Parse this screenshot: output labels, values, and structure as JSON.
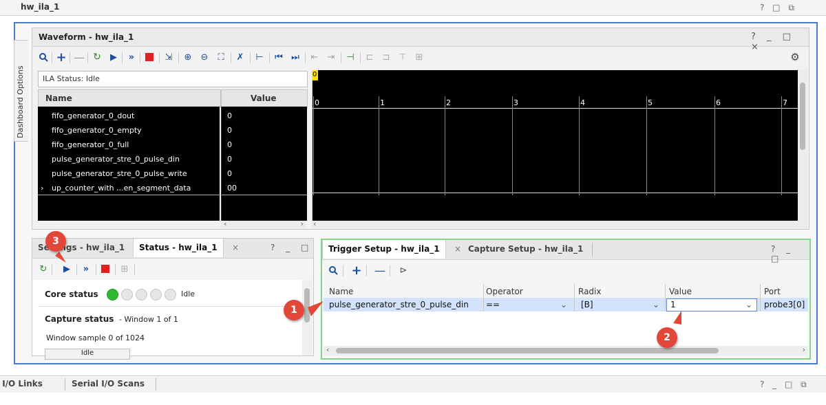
{
  "window": {
    "title": "hw_ila_1",
    "controls": "? □ ⧉"
  },
  "side_tab": {
    "label": "Dashboard Options"
  },
  "waveform": {
    "title": "Waveform - hw_ila_1",
    "controls": "? _ □ ×",
    "ila_status": "ILA Status: Idle",
    "name_header": "Name",
    "value_header": "Value",
    "cursor_marker": "0",
    "signals": [
      {
        "name": "fifo_generator_0_dout",
        "value": "0"
      },
      {
        "name": "fifo_generator_0_empty",
        "value": "0"
      },
      {
        "name": "fifo_generator_0_full",
        "value": "0"
      },
      {
        "name": "pulse_generator_stre_0_pulse_din",
        "value": "0"
      },
      {
        "name": "pulse_generator_stre_0_pulse_write",
        "value": "0"
      },
      {
        "name": "up_counter_with ...en_segment_data",
        "value": "00"
      }
    ],
    "time_ticks": [
      "0",
      "1",
      "2",
      "3",
      "4",
      "5",
      "6",
      "7"
    ]
  },
  "status_panel": {
    "tab_settings": "Settings - hw_ila_1",
    "tab_status": "Status - hw_ila_1",
    "controls": "? _ □",
    "core_status_label": "Core status",
    "core_status_value": "Idle",
    "capture_status_label": "Capture status",
    "capture_status_value": "- Window 1 of 1",
    "window_sample": "Window sample 0 of 1024",
    "idle_button": "Idle"
  },
  "trigger_panel": {
    "tab_trigger": "Trigger Setup - hw_ila_1",
    "tab_capture": "Capture Setup - hw_ila_1",
    "controls": "? _ □",
    "columns": [
      "Name",
      "Operator",
      "Radix",
      "Value",
      "Port"
    ],
    "row": {
      "name": "pulse_generator_stre_0_pulse_din",
      "operator": "==",
      "radix": "[B]",
      "value": "1",
      "port": "probe3[0]"
    }
  },
  "bottom_bar": {
    "tab_links": "Serial I/O Links",
    "tab_scans": "Serial I/O Scans",
    "controls": "? _ □ ⧉"
  },
  "callouts": [
    "1",
    "2",
    "3"
  ],
  "colors": {
    "accent": "#4a7cc9",
    "trigger_border": "#86d486",
    "badge": "#e2473a",
    "status_on": "#2eb82e"
  }
}
